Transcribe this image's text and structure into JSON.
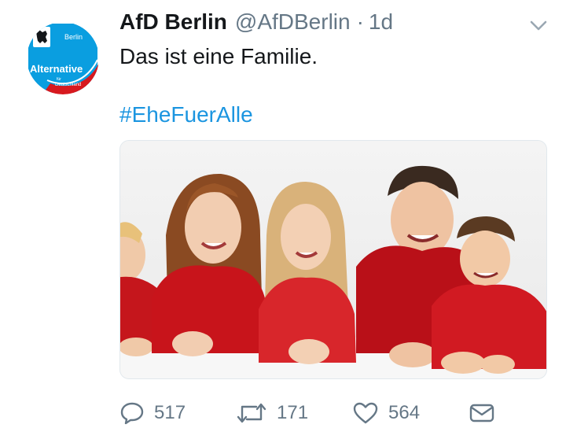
{
  "tweet": {
    "author": {
      "display_name": "AfD Berlin",
      "handle": "@AfDBerlin",
      "avatar": {
        "region_label": "Berlin",
        "party_name": "Alternative",
        "party_suffix_1": "für",
        "party_suffix_2": "Deutschland"
      }
    },
    "separator": "·",
    "time": "1d",
    "text": "Das ist eine Familie.",
    "hashtag": "#EheFuerAlle",
    "media": {
      "icon": "photo",
      "alt": ""
    },
    "actions": {
      "reply_count": "517",
      "retweet_count": "171",
      "like_count": "564"
    },
    "colors": {
      "link": "#1b95e0",
      "muted": "#657786",
      "brand_blue": "#0a9ee0",
      "brand_red": "#d7191f"
    }
  }
}
